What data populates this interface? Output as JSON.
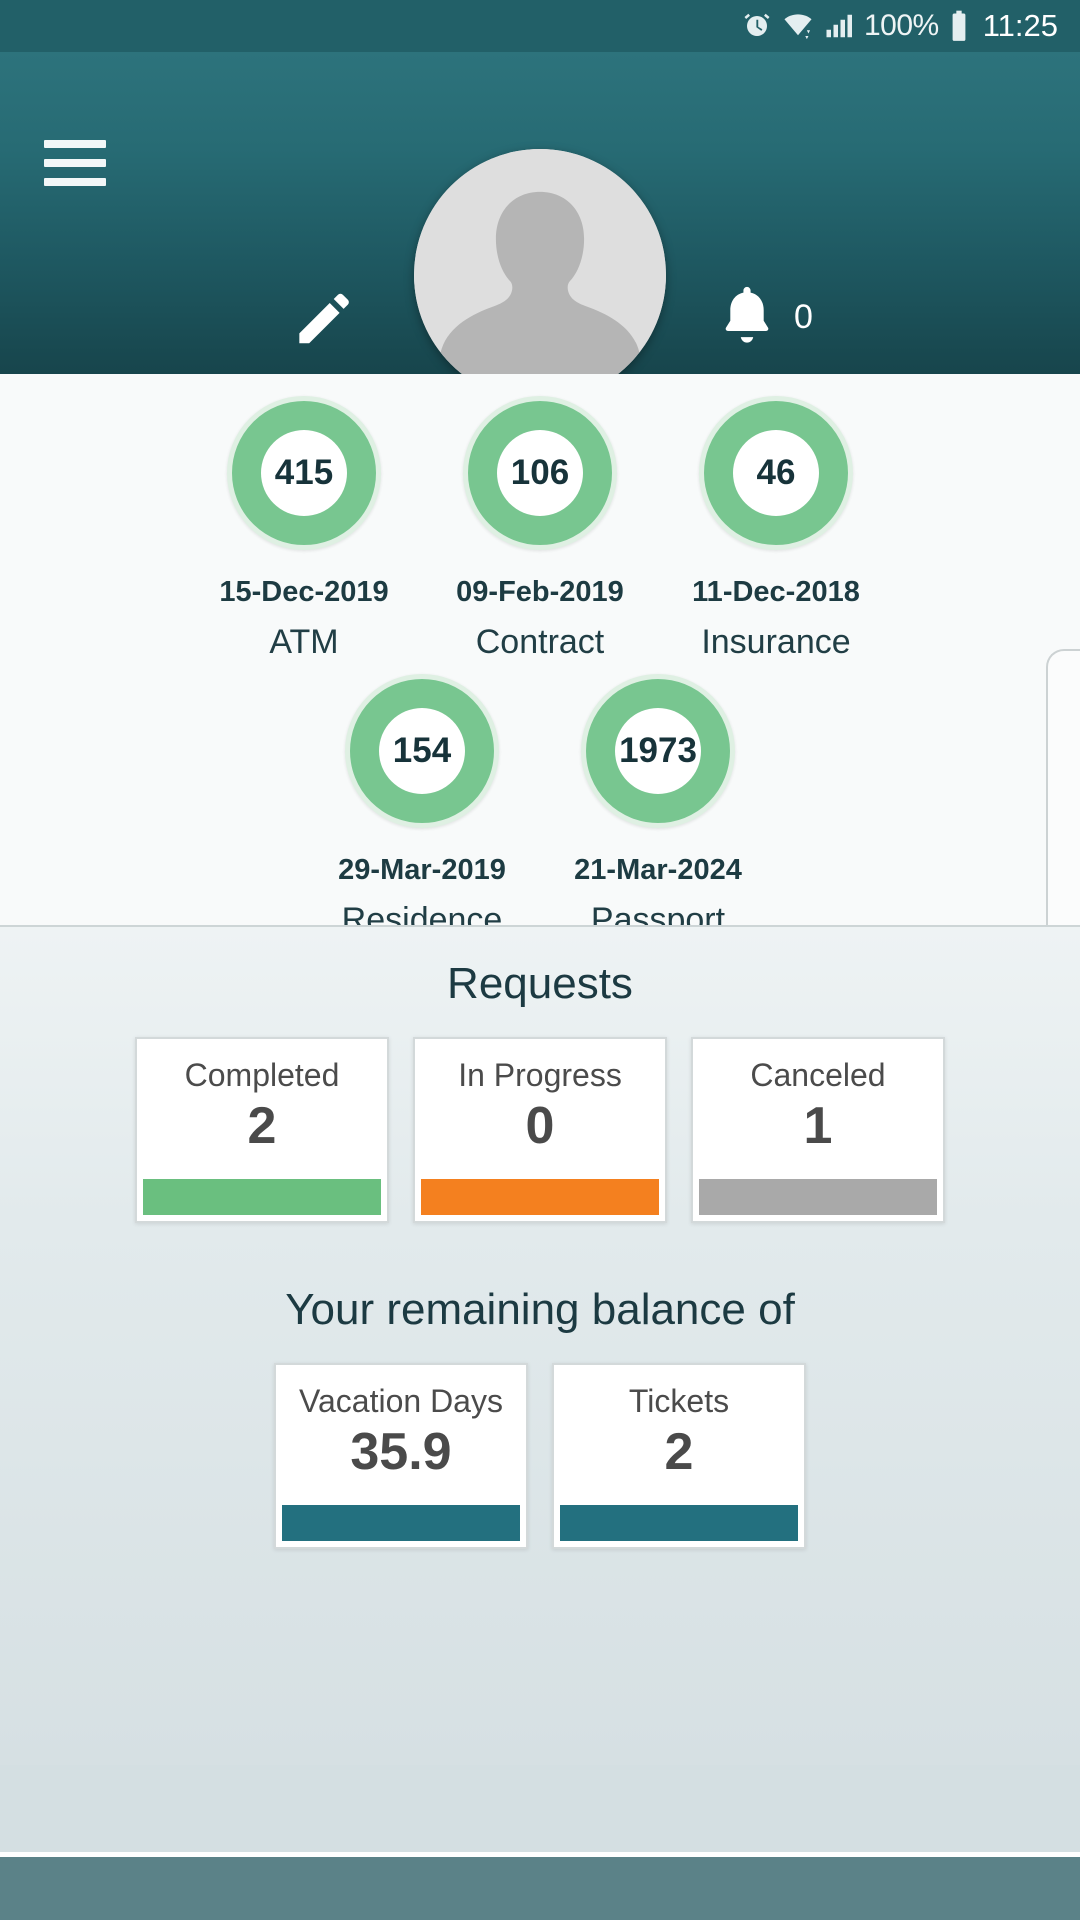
{
  "status_bar": {
    "alarm_icon": "alarm-icon",
    "wifi_icon": "wifi-icon",
    "signal_icon": "cellular-signal-icon",
    "battery_percent": "100%",
    "battery_icon": "battery-full-icon",
    "time": "11:25"
  },
  "header": {
    "menu_icon": "hamburger-menu-icon",
    "edit_icon": "edit-pencil-icon",
    "avatar_icon": "default-user-avatar",
    "bell_icon": "notification-bell-icon",
    "notification_count": "0",
    "gradient_top": "#2d737c",
    "gradient_bottom": "#17454c"
  },
  "documents": {
    "ring_color": "#78c690",
    "ring_halo_color": "#dff0e3",
    "items": [
      {
        "value": "415",
        "date": "15-Dec-2019",
        "label": "ATM"
      },
      {
        "value": "106",
        "date": "09-Feb-2019",
        "label": "Contract"
      },
      {
        "value": "46",
        "date": "11-Dec-2018",
        "label": "Insurance"
      },
      {
        "value": "154",
        "date": "29-Mar-2019",
        "label": "Residence"
      },
      {
        "value": "1973",
        "date": "21-Mar-2024",
        "label": "Passport"
      }
    ]
  },
  "requests": {
    "title": "Requests",
    "cards": [
      {
        "title": "Completed",
        "value": "2",
        "color": "#6abf7f"
      },
      {
        "title": "In Progress",
        "value": "0",
        "color": "#f4801f"
      },
      {
        "title": "Canceled",
        "value": "1",
        "color": "#a9a9a9"
      }
    ]
  },
  "balance": {
    "title": "Your remaining balance of",
    "cards": [
      {
        "title": "Vacation Days",
        "value": "35.9",
        "color": "#23707f"
      },
      {
        "title": "Tickets",
        "value": "2",
        "color": "#23707f"
      }
    ]
  },
  "bottom_nav": {
    "color": "#5b8288"
  }
}
